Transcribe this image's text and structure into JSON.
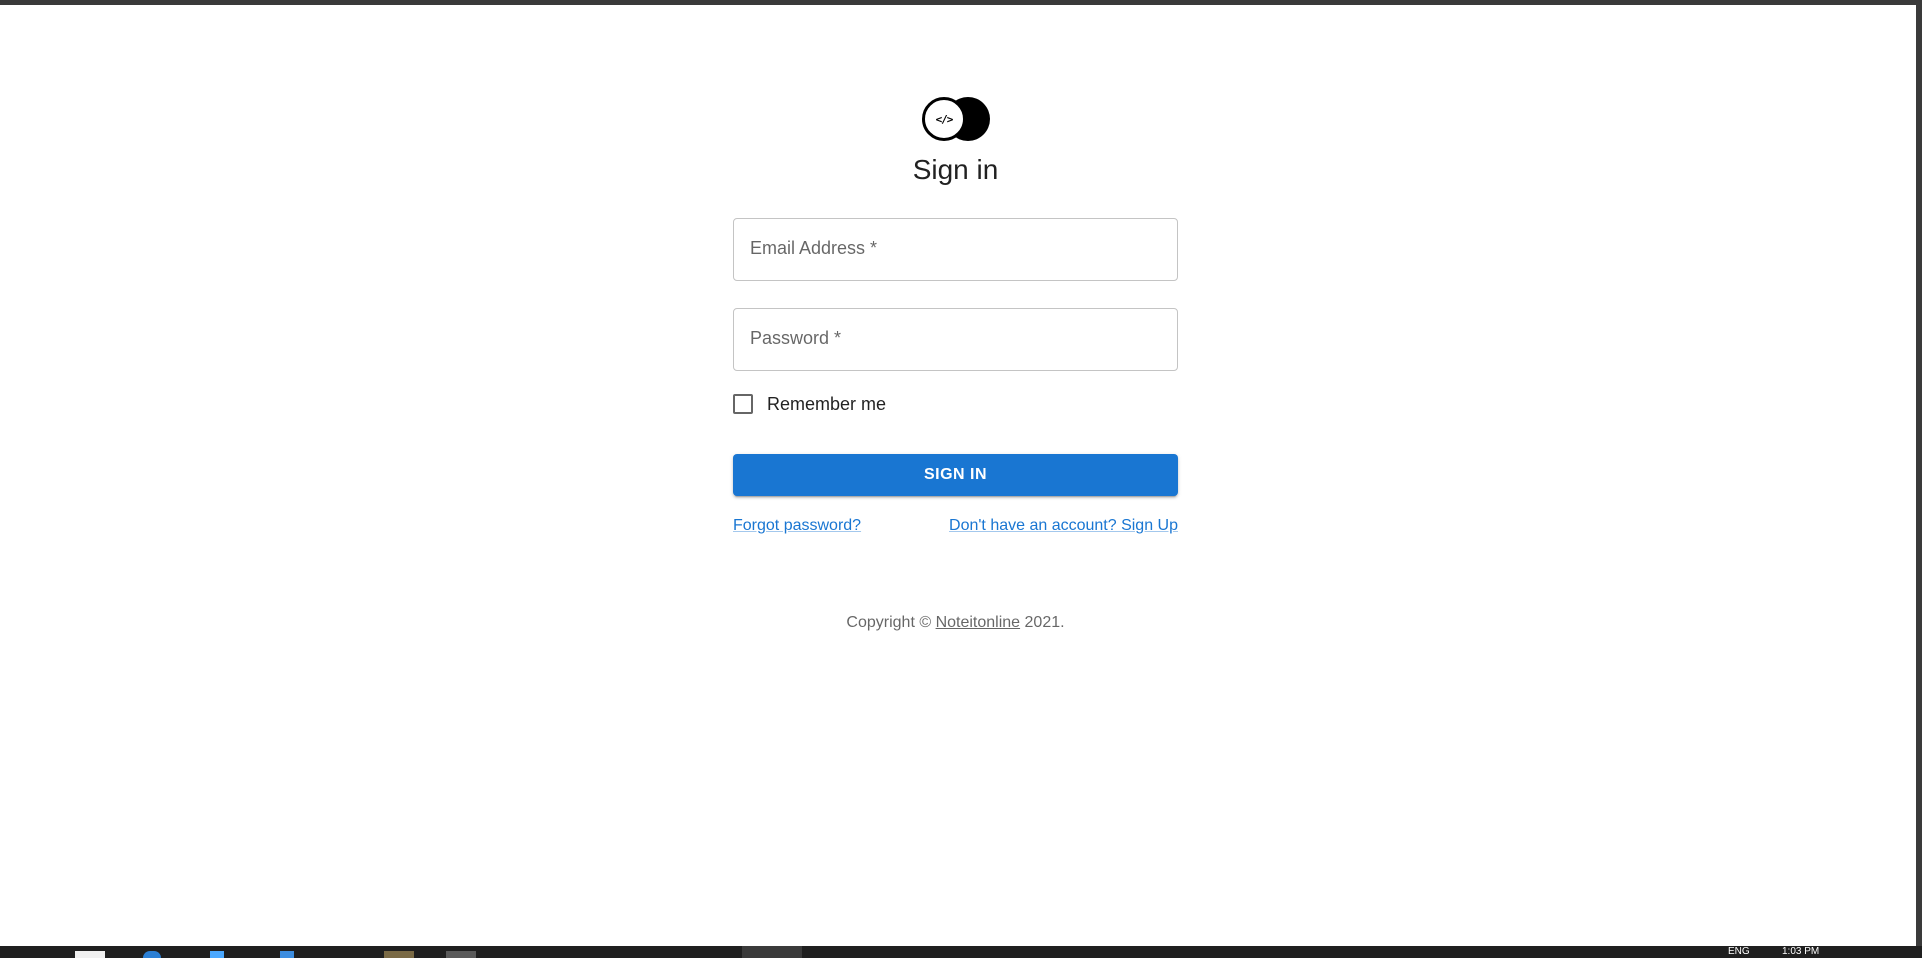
{
  "logo": {
    "icon": "code-brackets-icon",
    "symbol": "</>"
  },
  "form": {
    "title": "Sign in",
    "email_label": "Email Address *",
    "password_label": "Password *",
    "remember_label": "Remember me",
    "remember_checked": false,
    "submit_label": "SIGN IN",
    "forgot_link": "Forgot password?",
    "signup_link": "Don't have an account? Sign Up"
  },
  "footer": {
    "copyright_prefix": "Copyright ©",
    "brand": "Noteitonline",
    "year": "2021."
  },
  "taskbar": {
    "language": "ENG",
    "time": "1:03 PM"
  },
  "colors": {
    "primary": "#1976d2",
    "text": "#212121",
    "border": "#c4c4c4",
    "frame": "#3a3a3a"
  }
}
